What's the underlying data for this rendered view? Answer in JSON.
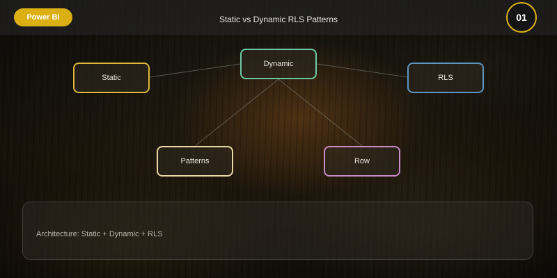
{
  "header": {
    "brand": "Power BI",
    "title": "Static vs Dynamic RLS Patterns",
    "slide_number": "01"
  },
  "diagram": {
    "nodes": [
      {
        "id": "static",
        "label": "Static",
        "border_color": "#ddb938"
      },
      {
        "id": "dynamic",
        "label": "Dynamic",
        "border_color": "#6cc9a3"
      },
      {
        "id": "rls",
        "label": "RLS",
        "border_color": "#5f96c4"
      },
      {
        "id": "patterns",
        "label": "Patterns",
        "border_color": "#e8d9a5"
      },
      {
        "id": "row",
        "label": "Row",
        "border_color": "#c78bc5"
      }
    ],
    "edges": [
      {
        "from": "dynamic",
        "to": "static"
      },
      {
        "from": "dynamic",
        "to": "rls"
      },
      {
        "from": "dynamic",
        "to": "patterns"
      },
      {
        "from": "dynamic",
        "to": "row"
      }
    ]
  },
  "footer": {
    "text": "Architecture: Static + Dynamic + RLS"
  },
  "colors": {
    "accent": "#dcb012",
    "connector": "#8a8a80"
  }
}
